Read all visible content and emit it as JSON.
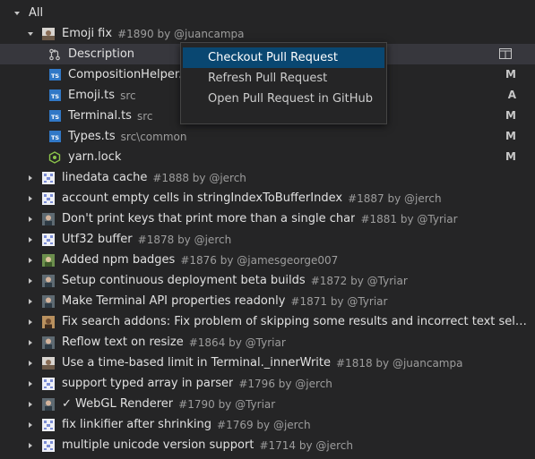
{
  "root": {
    "label": "All"
  },
  "pr_expanded": {
    "title": "Emoji fix",
    "meta": "#1890 by @juancampa",
    "children": [
      {
        "label": "Description",
        "icon": "pull-request-icon",
        "status": ""
      },
      {
        "label": "CompositionHelper.ts",
        "sub": "",
        "icon": "typescript-icon",
        "status": "M"
      },
      {
        "label": "Emoji.ts",
        "sub": "src",
        "icon": "typescript-icon",
        "status": "A"
      },
      {
        "label": "Terminal.ts",
        "sub": "src",
        "icon": "typescript-icon",
        "status": "M"
      },
      {
        "label": "Types.ts",
        "sub": "src\\common",
        "icon": "typescript-icon",
        "status": "M"
      },
      {
        "label": "yarn.lock",
        "sub": "",
        "icon": "lockfile-icon",
        "status": "M"
      }
    ]
  },
  "pull_requests": [
    {
      "title": "linedata cache",
      "meta": "#1888 by @jerch",
      "avatar": "pattern"
    },
    {
      "title": "account empty cells in stringIndexToBufferIndex",
      "meta": "#1887 by @jerch",
      "avatar": "pattern"
    },
    {
      "title": "Don't print keys that print more than a single char",
      "meta": "#1881 by @Tyriar",
      "avatar": "person"
    },
    {
      "title": "Utf32 buffer",
      "meta": "#1878 by @jerch",
      "avatar": "pattern"
    },
    {
      "title": "Added npm badges",
      "meta": "#1876 by @jamesgeorge007",
      "avatar": "photo"
    },
    {
      "title": "Setup continuous deployment beta builds",
      "meta": "#1872 by @Tyriar",
      "avatar": "person"
    },
    {
      "title": "Make Terminal API properties readonly",
      "meta": "#1871 by @Tyriar",
      "avatar": "person"
    },
    {
      "title": "Fix search addons: Fix problem of skipping some results and incorrect text selection ...",
      "meta": "",
      "avatar": "person2"
    },
    {
      "title": "Reflow text on resize",
      "meta": "#1864 by @Tyriar",
      "avatar": "person"
    },
    {
      "title": "Use a time-based limit in Terminal._innerWrite",
      "meta": "#1818 by @juancampa",
      "avatar": "landscape"
    },
    {
      "title": "support typed array in parser",
      "meta": "#1796 by @jerch",
      "avatar": "pattern"
    },
    {
      "title": "✓ WebGL Renderer",
      "meta": "#1790 by @Tyriar",
      "avatar": "person"
    },
    {
      "title": "fix linkifier after shrinking",
      "meta": "#1769 by @jerch",
      "avatar": "pattern"
    },
    {
      "title": "multiple unicode version support",
      "meta": "#1714 by @jerch",
      "avatar": "pattern"
    }
  ],
  "context_menu": {
    "items": [
      {
        "label": "Checkout Pull Request",
        "active": true
      },
      {
        "label": "Refresh Pull Request",
        "active": false
      },
      {
        "label": "Open Pull Request in GitHub",
        "active": false
      }
    ]
  },
  "colors": {
    "background": "#252526",
    "selection": "#37373d",
    "menu_highlight": "#094771",
    "typescript": "#3178c6",
    "yarn": "#8bc34a"
  }
}
